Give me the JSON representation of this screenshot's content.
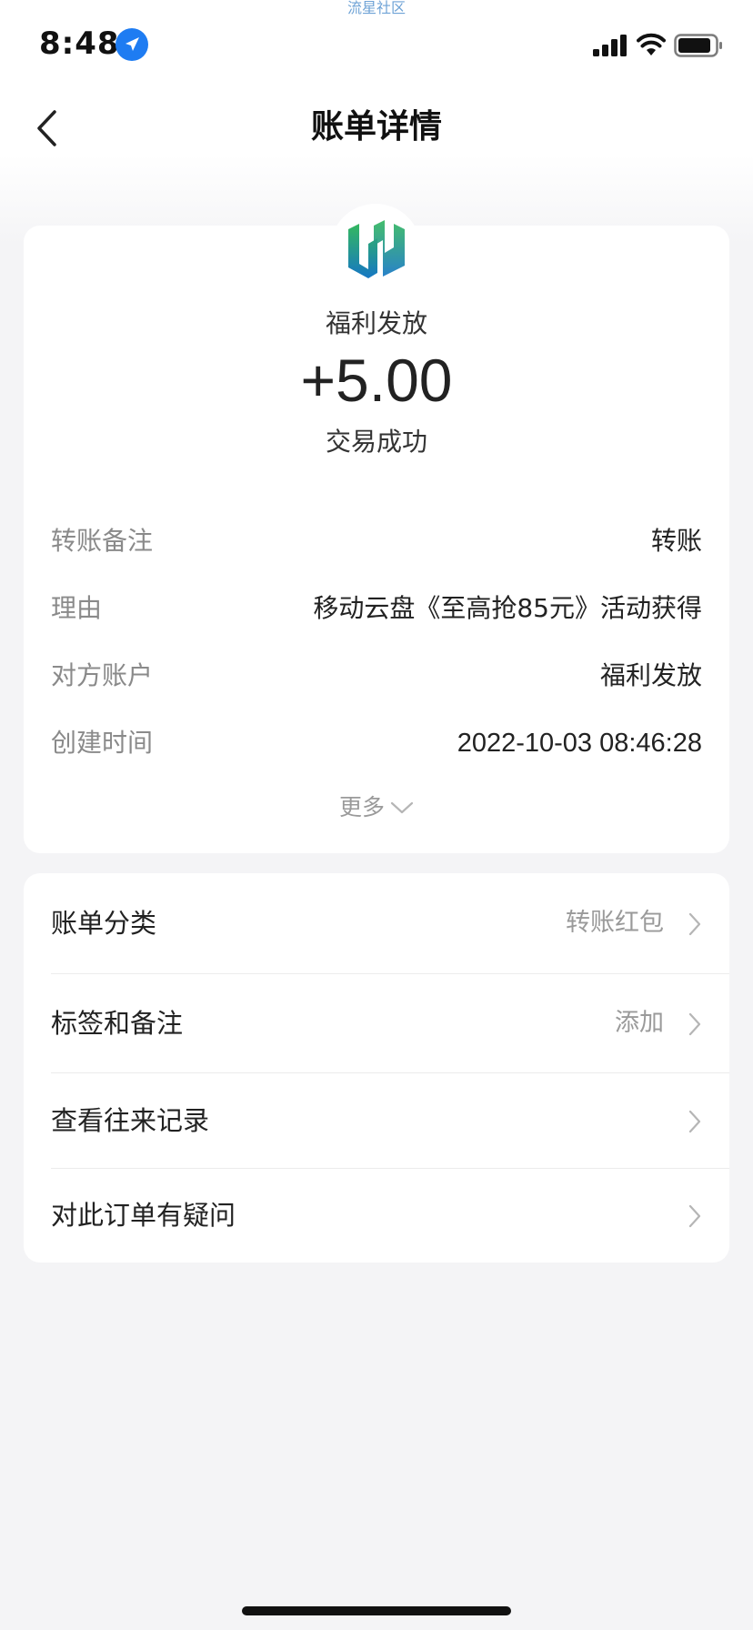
{
  "watermark": "流星社区",
  "status_bar": {
    "time": "8:48"
  },
  "nav": {
    "title": "账单详情"
  },
  "summary": {
    "payee": "福利发放",
    "amount": "+5.00",
    "status": "交易成功"
  },
  "details": [
    {
      "label": "转账备注",
      "value": "转账"
    },
    {
      "label": "理由",
      "value": "移动云盘《至高抢85元》活动获得"
    },
    {
      "label": "对方账户",
      "value": "福利发放"
    },
    {
      "label": "创建时间",
      "value": "2022-10-03 08:46:28"
    }
  ],
  "more_label": "更多",
  "actions": [
    {
      "label": "账单分类",
      "value": "转账红包"
    },
    {
      "label": "标签和备注",
      "value": "添加"
    },
    {
      "label": "查看往来记录",
      "value": ""
    },
    {
      "label": "对此订单有疑问",
      "value": ""
    }
  ],
  "colors": {
    "accent_blue": "#1e7cf2",
    "logo_green": "#2fb36b",
    "logo_blue": "#1a7fc1"
  }
}
